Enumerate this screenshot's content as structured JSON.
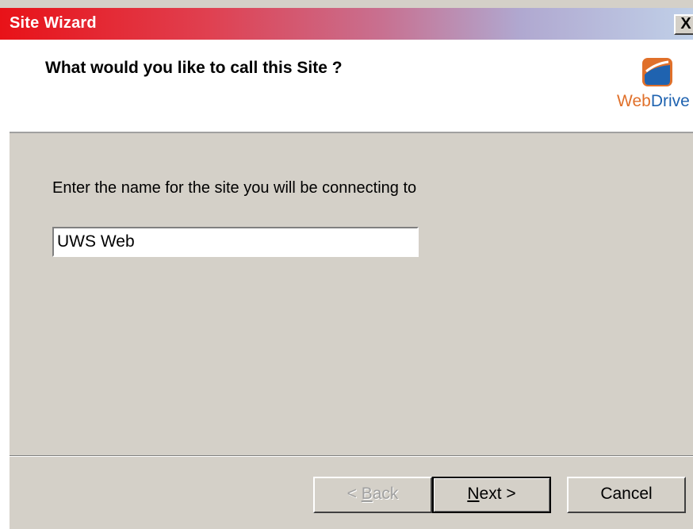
{
  "window": {
    "title": "Site Wizard",
    "close_label": "X"
  },
  "header": {
    "title": "What would you like to call this Site ?",
    "logo_text_web": "Web",
    "logo_text_drive": "Drive",
    "logo_icon": "webdrive-logo-icon"
  },
  "main": {
    "prompt": "Enter the name for the site you will be connecting to",
    "site_name_value": "UWS Web"
  },
  "buttons": {
    "back_prefix": "< ",
    "back_mnemonic": "B",
    "back_rest": "ack",
    "next_mnemonic": "N",
    "next_rest": "ext >",
    "cancel": "Cancel"
  },
  "colors": {
    "title_gradient_start": "#e81218",
    "title_gradient_end": "#c0d0e8",
    "logo_orange": "#e0702a",
    "logo_blue": "#1f63b0",
    "dialog_bg": "#d4d0c8"
  }
}
